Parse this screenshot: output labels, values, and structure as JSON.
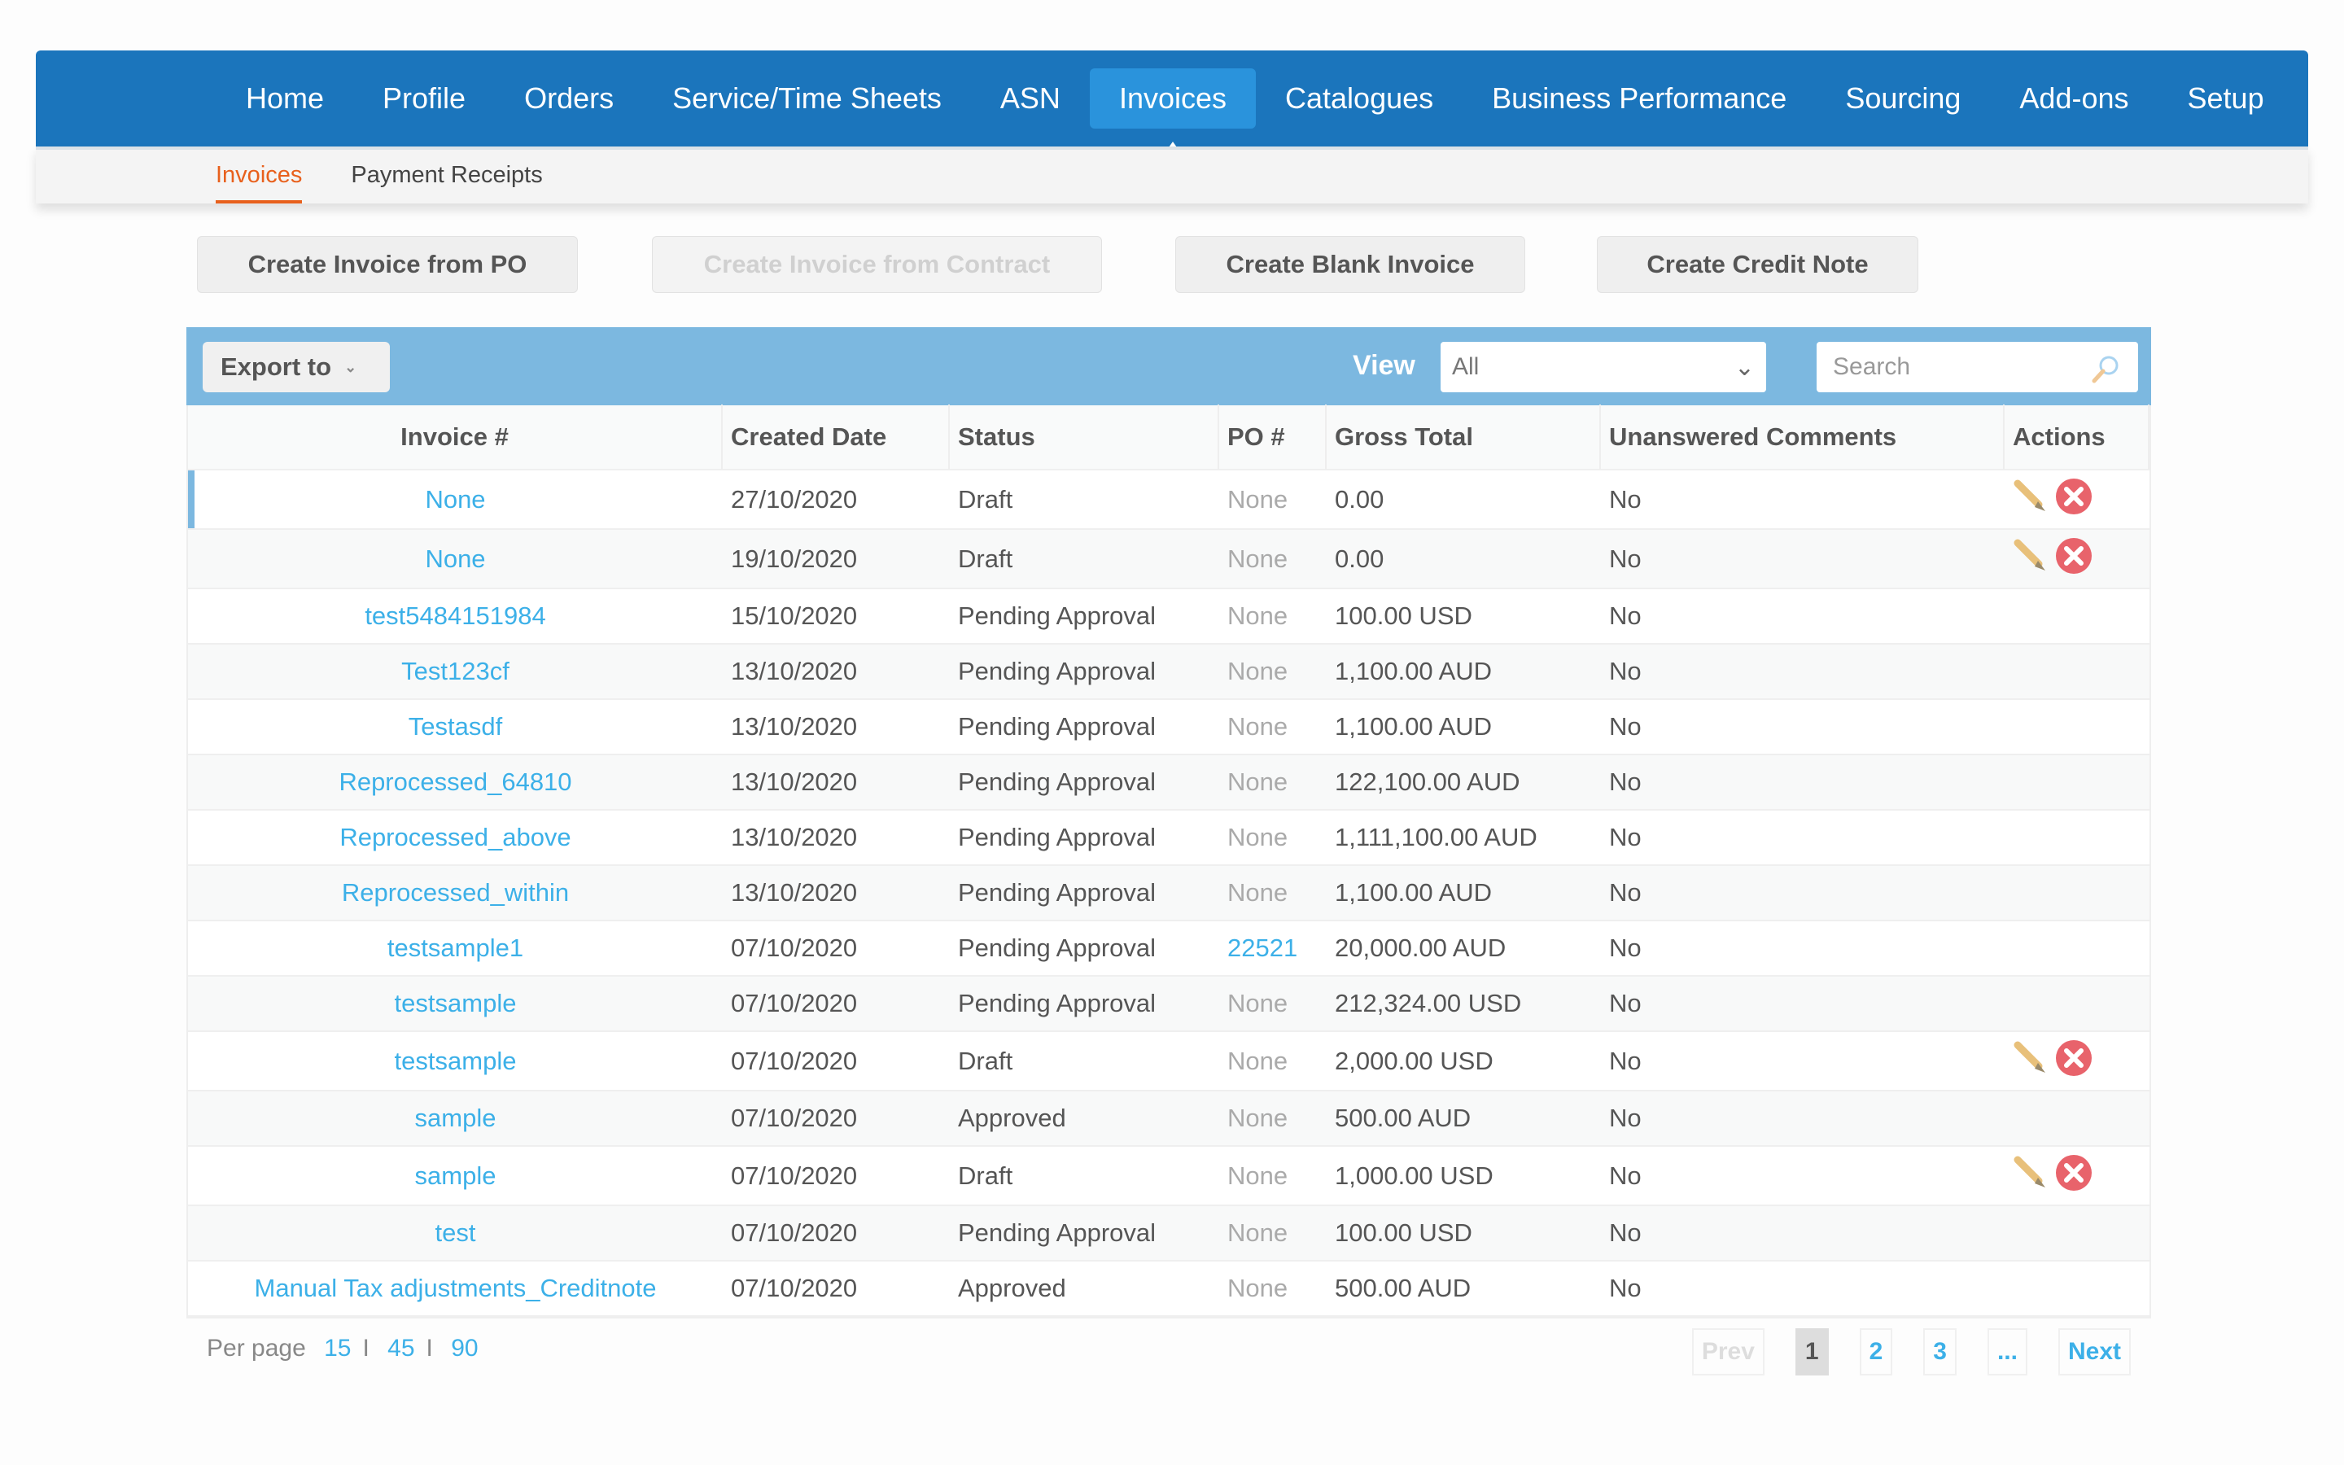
{
  "nav": {
    "items": [
      "Home",
      "Profile",
      "Orders",
      "Service/Time Sheets",
      "ASN",
      "Invoices",
      "Catalogues",
      "Business Performance",
      "Sourcing",
      "Add-ons",
      "Setup"
    ],
    "active": "Invoices"
  },
  "subnav": {
    "items": [
      "Invoices",
      "Payment Receipts"
    ],
    "active": "Invoices"
  },
  "actions": {
    "create_from_po": "Create Invoice from PO",
    "create_from_contract": "Create Invoice from Contract",
    "create_blank": "Create Blank Invoice",
    "create_credit_note": "Create Credit Note"
  },
  "toolbar": {
    "export": "Export to",
    "view_label": "View",
    "view_value": "All",
    "search_placeholder": "Search"
  },
  "table": {
    "headers": [
      "Invoice #",
      "Created Date",
      "Status",
      "PO #",
      "Gross Total",
      "Unanswered Comments",
      "Actions"
    ],
    "rows": [
      {
        "invoice": "None",
        "date": "27/10/2020",
        "status": "Draft",
        "po": "None",
        "total": "0.00",
        "comments": "No",
        "actions": true
      },
      {
        "invoice": "None",
        "date": "19/10/2020",
        "status": "Draft",
        "po": "None",
        "total": "0.00",
        "comments": "No",
        "actions": true
      },
      {
        "invoice": "test5484151984",
        "date": "15/10/2020",
        "status": "Pending Approval",
        "po": "None",
        "total": "100.00 USD",
        "comments": "No",
        "actions": false
      },
      {
        "invoice": "Test123cf",
        "date": "13/10/2020",
        "status": "Pending Approval",
        "po": "None",
        "total": "1,100.00 AUD",
        "comments": "No",
        "actions": false
      },
      {
        "invoice": "Testasdf",
        "date": "13/10/2020",
        "status": "Pending Approval",
        "po": "None",
        "total": "1,100.00 AUD",
        "comments": "No",
        "actions": false
      },
      {
        "invoice": "Reprocessed_64810",
        "date": "13/10/2020",
        "status": "Pending Approval",
        "po": "None",
        "total": "122,100.00 AUD",
        "comments": "No",
        "actions": false
      },
      {
        "invoice": "Reprocessed_above",
        "date": "13/10/2020",
        "status": "Pending Approval",
        "po": "None",
        "total": "1,111,100.00 AUD",
        "comments": "No",
        "actions": false
      },
      {
        "invoice": "Reprocessed_within",
        "date": "13/10/2020",
        "status": "Pending Approval",
        "po": "None",
        "total": "1,100.00 AUD",
        "comments": "No",
        "actions": false
      },
      {
        "invoice": "testsample1",
        "date": "07/10/2020",
        "status": "Pending Approval",
        "po": "22521",
        "total": "20,000.00 AUD",
        "comments": "No",
        "actions": false
      },
      {
        "invoice": "testsample",
        "date": "07/10/2020",
        "status": "Pending Approval",
        "po": "None",
        "total": "212,324.00 USD",
        "comments": "No",
        "actions": false
      },
      {
        "invoice": "testsample",
        "date": "07/10/2020",
        "status": "Draft",
        "po": "None",
        "total": "2,000.00 USD",
        "comments": "No",
        "actions": true
      },
      {
        "invoice": "sample",
        "date": "07/10/2020",
        "status": "Approved",
        "po": "None",
        "total": "500.00 AUD",
        "comments": "No",
        "actions": false
      },
      {
        "invoice": "sample",
        "date": "07/10/2020",
        "status": "Draft",
        "po": "None",
        "total": "1,000.00 USD",
        "comments": "No",
        "actions": true
      },
      {
        "invoice": "test",
        "date": "07/10/2020",
        "status": "Pending Approval",
        "po": "None",
        "total": "100.00 USD",
        "comments": "No",
        "actions": false
      },
      {
        "invoice": "Manual Tax adjustments_Creditnote",
        "date": "07/10/2020",
        "status": "Approved",
        "po": "None",
        "total": "500.00 AUD",
        "comments": "No",
        "actions": false
      }
    ]
  },
  "footer": {
    "per_page_label": "Per page",
    "per_page_options": [
      "15",
      "45",
      "90"
    ],
    "separator": "I"
  },
  "pagination": {
    "prev": "Prev",
    "pages": [
      "1",
      "2",
      "3"
    ],
    "current": "1",
    "ellipsis": "...",
    "next": "Next"
  },
  "colors": {
    "nav": "#1b75bc",
    "toolbar": "#7cb8e0",
    "link": "#3cb0e8",
    "active_subnav": "#e8601c",
    "delete": "#e8636b"
  }
}
